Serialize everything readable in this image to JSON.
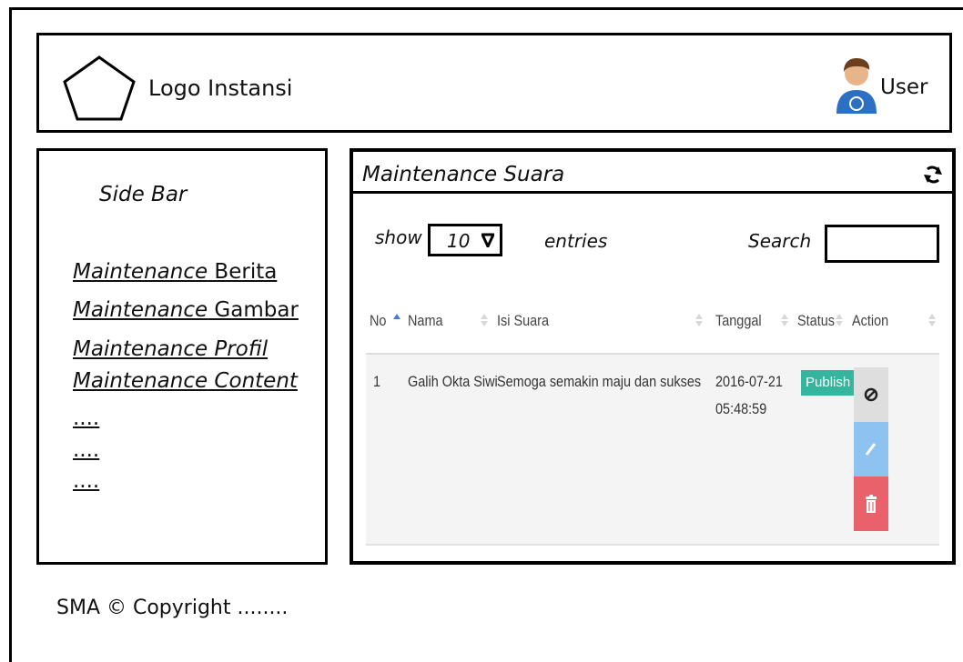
{
  "header": {
    "logo_label": "Logo Instansi",
    "user_label": "User"
  },
  "sidebar": {
    "title": "Side Bar",
    "items": [
      {
        "prefix": "Maintenance",
        "rest": " Berita",
        "rest_italic": false
      },
      {
        "prefix": "Maintenance",
        "rest": " Gambar",
        "rest_italic": false
      },
      {
        "prefix": "Maintenance",
        "rest": " Profil",
        "rest_italic": true
      },
      {
        "prefix": "Maintenance",
        "rest": " Content",
        "rest_italic": true
      },
      {
        "prefix": "....",
        "rest": "",
        "rest_italic": false
      },
      {
        "prefix": "....",
        "rest": "",
        "rest_italic": false
      },
      {
        "prefix": "....",
        "rest": "",
        "rest_italic": false
      }
    ]
  },
  "panel": {
    "title": "Maintenance Suara",
    "controls": {
      "show_label": "show",
      "length_value": "10",
      "entries_label": "entries",
      "search_label": "Search",
      "search_value": ""
    },
    "table": {
      "columns": [
        "No",
        "Nama",
        "Isi Suara",
        "Tanggal",
        "Status",
        "Action"
      ],
      "rows": [
        {
          "no": "1",
          "nama": "Galih Okta Siwi",
          "isi_suara": "Semoga semakin maju dan sukses",
          "tanggal_date": "2016-07-21",
          "tanggal_time": "05:48:59",
          "status": "Publish"
        }
      ]
    }
  },
  "footer": {
    "text": "SMA © Copyright  ........"
  },
  "colors": {
    "publish": "#35b49e",
    "btn_disable": "#dedede",
    "btn_edit": "#8ec3f1",
    "btn_delete": "#e8616b",
    "sort_active": "#4a7ad9"
  }
}
